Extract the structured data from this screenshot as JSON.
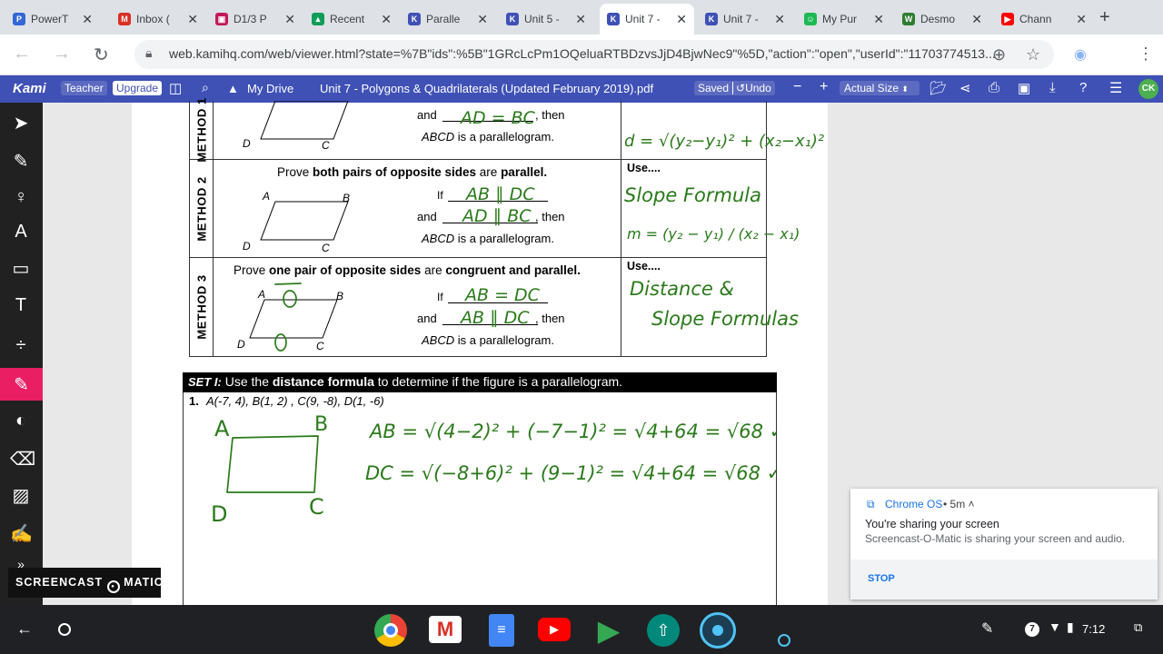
{
  "browser": {
    "tabs": [
      {
        "label": "PowerT",
        "fav": "P",
        "color": "#3367d6"
      },
      {
        "label": "Inbox (",
        "fav": "M",
        "color": "#d93025"
      },
      {
        "label": "D1/3 P",
        "fav": "▣",
        "color": "#c2185b"
      },
      {
        "label": "Recent",
        "fav": "▲",
        "color": "#0f9d58"
      },
      {
        "label": "Paralle",
        "fav": "K",
        "color": "#3f51b5"
      },
      {
        "label": "Unit 5 -",
        "fav": "K",
        "color": "#3f51b5"
      },
      {
        "label": "Unit 7 -",
        "fav": "K",
        "color": "#3f51b5",
        "active": true
      },
      {
        "label": "Unit 7 -",
        "fav": "K",
        "color": "#3f51b5"
      },
      {
        "label": "My Pur",
        "fav": "☺",
        "color": "#1db954"
      },
      {
        "label": "Desmo",
        "fav": "W",
        "color": "#2e7d32"
      },
      {
        "label": "Chann",
        "fav": "▶",
        "color": "#ff0000"
      }
    ],
    "url": "web.kamihq.com/web/viewer.html?state=%7B\"ids\":%5B\"1GRcLcPm1OQeluaRTBDzvsJjD4BjwNec9\"%5D,\"action\":\"open\",\"userId\":\"11703774513..."
  },
  "kami": {
    "logo": "Kami",
    "teacher": "Teacher",
    "upgrade": "Upgrade",
    "drive": "My Drive",
    "filename": "Unit 7 - Polygons & Quadrilaterals (Updated February 2019).pdf",
    "saved": "Saved",
    "undo": "Undo",
    "zoom": "Actual Size",
    "avatar": "CK"
  },
  "doc": {
    "method1": {
      "label": "METHOD 1",
      "and": "and",
      "then": ", then",
      "conclusion_var": "ABCD",
      "conclusion": " is a parallelogram.",
      "handwritten_blank": "AD = BC",
      "handwritten_use": "d = √(y₂−y₁)² + (x₂−x₁)²"
    },
    "method2": {
      "label": "METHOD 2",
      "prompt_a": "Prove ",
      "prompt_b": "both pairs of opposite sides",
      "prompt_c": " are ",
      "prompt_d": "parallel.",
      "if": "If",
      "and": "and",
      "then": ", then",
      "conclusion_var": "ABCD",
      "conclusion": " is a parallelogram.",
      "use": "Use....",
      "handwritten_blank1": "AB ∥ DC",
      "handwritten_blank2": "AD ∥ BC",
      "handwritten_use1": "Slope Formula",
      "handwritten_use2": "m = (y₂ − y₁) / (x₂ − x₁)"
    },
    "method3": {
      "label": "METHOD 3",
      "prompt_a": "Prove ",
      "prompt_b": "one pair of opposite sides",
      "prompt_c": " are ",
      "prompt_d": "congruent and parallel.",
      "if": "If",
      "and": "and",
      "then": ", then",
      "conclusion_var": "ABCD",
      "conclusion": " is a parallelogram.",
      "use": "Use....",
      "handwritten_blank1": "AB = DC",
      "handwritten_blank2": "AB ∥ DC",
      "handwritten_use1": "Distance &",
      "handwritten_use2": "Slope Formulas"
    },
    "vertices": {
      "a": "A",
      "b": "B",
      "c": "C",
      "d": "D"
    },
    "set1": {
      "tag": "SET I:",
      "text_a": "Use the ",
      "text_b": "distance formula",
      "text_c": " to determine if the figure is a parallelogram.",
      "problem_num": "1.",
      "points": "A(-7, 4), B(1, 2) , C(9, -8), D(1, -6)",
      "work_ab": "AB = √(4−2)² + (−7−1)² = √4+64 = √68 ✓",
      "work_dc": "DC = √(−8+6)² + (9−1)² = √4+64 = √68 ✓"
    }
  },
  "notification": {
    "source": "Chrome OS",
    "time": "• 5m ˄",
    "title": "You're sharing your screen",
    "body": "Screencast-O-Matic is sharing your screen and audio.",
    "action": "STOP"
  },
  "watermark": "SCREENCAST",
  "watermark_b": "MATIC",
  "shelf": {
    "notif_count": "7",
    "time": "7:12"
  }
}
